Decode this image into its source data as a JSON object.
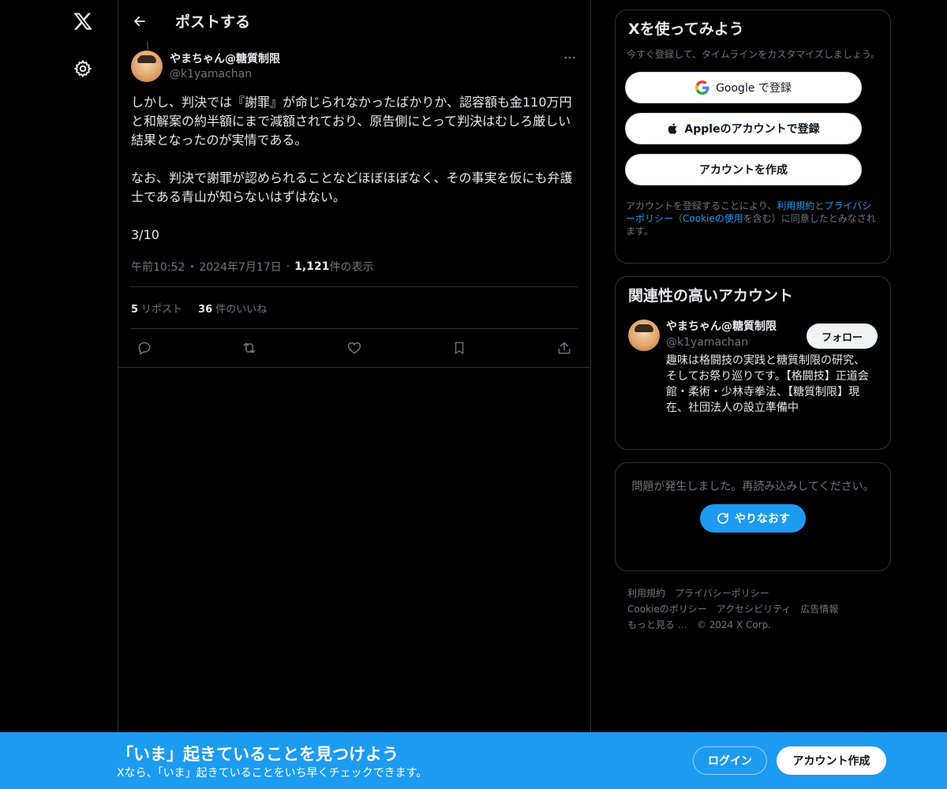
{
  "nav": {
    "logo_icon": "x-logo-icon",
    "settings_icon": "gear-icon"
  },
  "header": {
    "title": "ポストする",
    "back_icon": "arrow-left-icon"
  },
  "post": {
    "author_name": "やまちゃん@糖質制限",
    "author_handle": "@k1yamachan",
    "body": "しかし、判決では『謝罪』が命じられなかったばかりか、認容額も金110万円と和解案の約半額にまで減額されており、原告側にとって判決はむしろ厳しい結果となったのが実情である。\n\nなお、判決で謝罪が認められることなどほぼほぼなく、その事実を仮にも弁護士である青山が知らないはずはない。\n\n3/10",
    "time": "午前10:52",
    "sep": "・",
    "date": "2024年7月17日",
    "views_count": "1,121",
    "views_label": " 件の表示",
    "reposts_count": "5",
    "reposts_label": "リポスト",
    "likes_count": "36",
    "likes_label": "件のいいね"
  },
  "signup": {
    "title": "Xを使ってみよう",
    "desc": "今すぐ登録して、タイムラインをカスタマイズしましょう。",
    "google_label": "Google で登録",
    "apple_label": "Appleのアカウントで登録",
    "create_label": "アカウントを作成",
    "terms_1": "アカウントを登録することにより、",
    "terms_link_1": "利用規約",
    "terms_2": "と",
    "terms_link_2": "プライバシーポリシー",
    "terms_3": "（",
    "terms_link_3": "Cookieの使用",
    "terms_4": "を含む）に同意したとみなされます。"
  },
  "related": {
    "title": "関連性の高いアカウント",
    "name": "やまちゃん@糖質制限",
    "handle": "@k1yamachan",
    "follow_label": "フォロー",
    "bio": "趣味は格闘技の実践と糖質制限の研究、そしてお祭り巡りです。【格闘技】正道会館・柔術・少林寺拳法、【糖質制限】現在、社団法人の設立準備中"
  },
  "error": {
    "text": "問題が発生しました。再読み込みしてください。",
    "retry_label": "やりなおす"
  },
  "footer": {
    "links_row1": [
      "利用規約",
      "プライバシーポリシー"
    ],
    "links_row2": [
      "Cookieのポリシー",
      "アクセシビリティ",
      "広告情報"
    ],
    "more": "もっと見る …",
    "copyright": "© 2024 X Corp."
  },
  "banner": {
    "title": "「いま」起きていることを見つけよう",
    "subtitle": "Xなら、「いま」起きていることをいち早くチェックできます。",
    "login_label": "ログイン",
    "create_label": "アカウント作成"
  },
  "colors": {
    "accent": "#1d9bf0",
    "background": "#000000",
    "border": "#2f3336",
    "muted_text": "#71767b"
  }
}
